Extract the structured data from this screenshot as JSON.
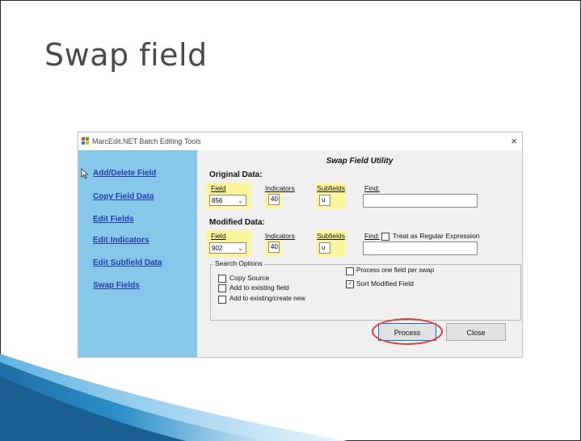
{
  "slide": {
    "title": "Swap field"
  },
  "dialog": {
    "window_title": "MarcEdit.NET Batch Editing Tools",
    "close_glyph": "×",
    "sidebar": {
      "items": [
        {
          "label": "Add/Delete Field"
        },
        {
          "label": "Copy Field Data"
        },
        {
          "label": "Edit Fields"
        },
        {
          "label": "Edit Indicators"
        },
        {
          "label": "Edit Subfield Data"
        },
        {
          "label": "Swap Fields"
        }
      ]
    },
    "utility_title": "Swap Field Utility",
    "original": {
      "label": "Original Data:",
      "field_label": "Field",
      "field_value": "856",
      "indicators_label": "Indicators",
      "indicators_value": "40",
      "subfields_label": "Subfields",
      "subfields_value": "u",
      "find_label": "Find:",
      "find_value": ""
    },
    "modified": {
      "label": "Modified Data:",
      "field_label": "Field",
      "field_value": "902",
      "indicators_label": "Indicators",
      "indicators_value": "40",
      "subfields_label": "Subfields",
      "subfields_value": "u",
      "find_label": "Find:",
      "regex_label": "Treat as Regular Expression",
      "regex_checked": false,
      "find_value": ""
    },
    "search_options": {
      "legend": "Search Options",
      "copy_source": {
        "label": "Copy Source",
        "checked": false
      },
      "add_existing": {
        "label": "Add to existing field",
        "checked": false
      },
      "add_create": {
        "label": "Add to existing/create new",
        "checked": false
      },
      "one_per_swap": {
        "label": "Process one field per swap",
        "checked": false
      },
      "sort_modified": {
        "label": "Sort Modified Field",
        "checked": true
      }
    },
    "buttons": {
      "process": "Process",
      "close": "Close"
    },
    "colors": {
      "sidebar": "#87c8ea",
      "highlight": "#fdf59b",
      "link": "#1f3fb0",
      "annotation": "#d9413d"
    }
  }
}
